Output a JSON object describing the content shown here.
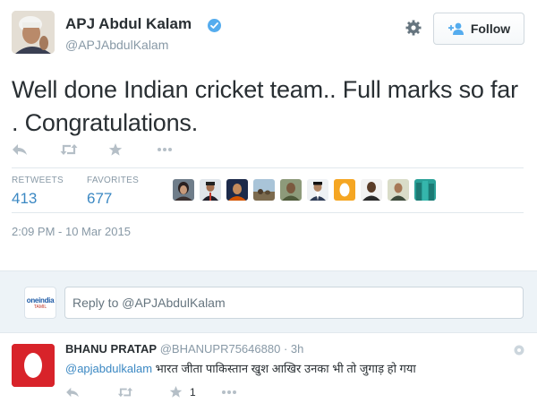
{
  "tweet": {
    "author_name": "APJ Abdul Kalam",
    "author_handle": "@APJAbdulKalam",
    "follow_label": "Follow",
    "text": "Well done Indian cricket team.. Full marks so far . Congratulations.",
    "stats": {
      "retweets_label": "RETWEETS",
      "retweets_value": "413",
      "favorites_label": "FAVORITES",
      "favorites_value": "677"
    },
    "timestamp": "2:09 PM - 10 Mar 2015"
  },
  "reply_box": {
    "placeholder": "Reply to @APJAbdulKalam",
    "logo_text": "oneindia",
    "logo_sub": "TAMIL"
  },
  "reply": {
    "author_name": "BHANU PRATAP",
    "author_handle": "@BHANUPR75646880",
    "separator": "·",
    "time": "3h",
    "mention": "@apjabdulkalam",
    "text": " भारत जीता पाकिस्तान खुश आखिर उनका भी तो जुगाड़ हो गया",
    "favorite_count": "1"
  },
  "icons": [
    "verified-badge-icon",
    "gear-icon",
    "follow-person-icon",
    "reply-icon",
    "retweet-icon",
    "favorite-star-icon",
    "more-dots-icon"
  ],
  "colors": {
    "link": "#3b88c3",
    "muted": "#8899a6",
    "verified": "#55acee",
    "reply_area_bg": "#edf3f7"
  }
}
